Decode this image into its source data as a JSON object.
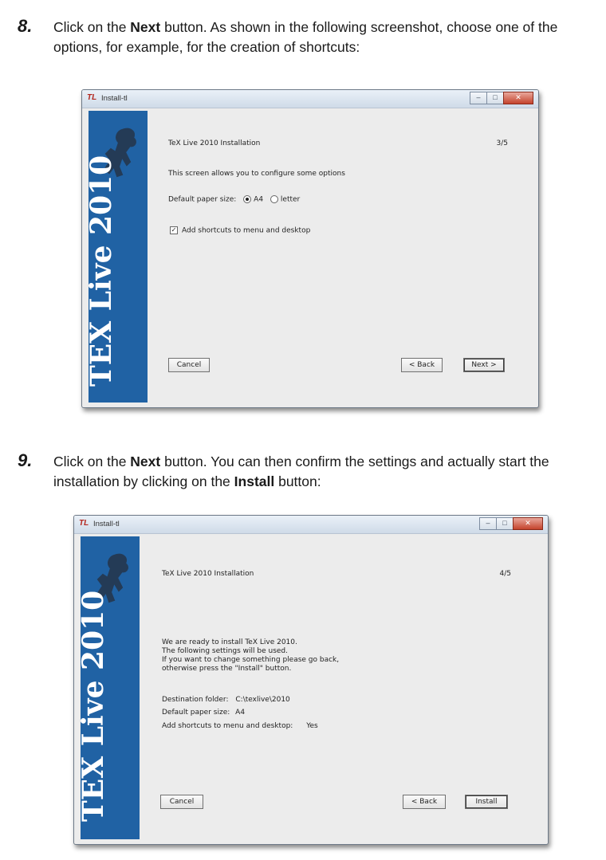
{
  "step8": {
    "number": "8.",
    "text_a": "Click on the ",
    "bold": "Next",
    "text_b": " button. As shown in the following screenshot, choose one of the options, for example, for the creation of shortcuts:"
  },
  "step9": {
    "number": "9.",
    "text_a": "Click on the ",
    "bold1": "Next",
    "text_b": " button. You can then confirm the settings and actually start the installation by clicking on the ",
    "bold2": "Install",
    "text_c": " button:"
  },
  "window1": {
    "title": "Install-tl",
    "icon": "tex-logo-icon",
    "sidebar_text": "TEX Live 2010",
    "heading": "TeX Live 2010 Installation",
    "step": "3/5",
    "intro": "This screen allows you to configure some options",
    "paper_label": "Default paper size:",
    "paper_options": [
      "A4",
      "letter"
    ],
    "paper_selected": "A4",
    "shortcut_label": "Add shortcuts to menu and desktop",
    "shortcut_checked": true,
    "cancel": "Cancel",
    "back": "< Back",
    "next": "Next >"
  },
  "window2": {
    "title": "Install-tl",
    "icon": "tex-logo-icon",
    "sidebar_text": "TEX Live 2010",
    "heading": "TeX Live 2010 Installation",
    "step": "4/5",
    "msg_lines": [
      "We are ready to install TeX Live 2010.",
      "The following settings will be used.",
      "If you want to change something please go back,",
      "otherwise press the \"Install\" button."
    ],
    "dest_label": "Destination folder:",
    "dest_value": "C:\\texlive\\2010",
    "paper_label": "Default paper size:",
    "paper_value": "A4",
    "shortcut_label": "Add shortcuts to menu and desktop:",
    "shortcut_value": "Yes",
    "cancel": "Cancel",
    "back": "< Back",
    "install": "Install"
  },
  "colors": {
    "sidebar": "#2062a4",
    "window_bg": "#ececec",
    "close_button": "#c4432d"
  }
}
